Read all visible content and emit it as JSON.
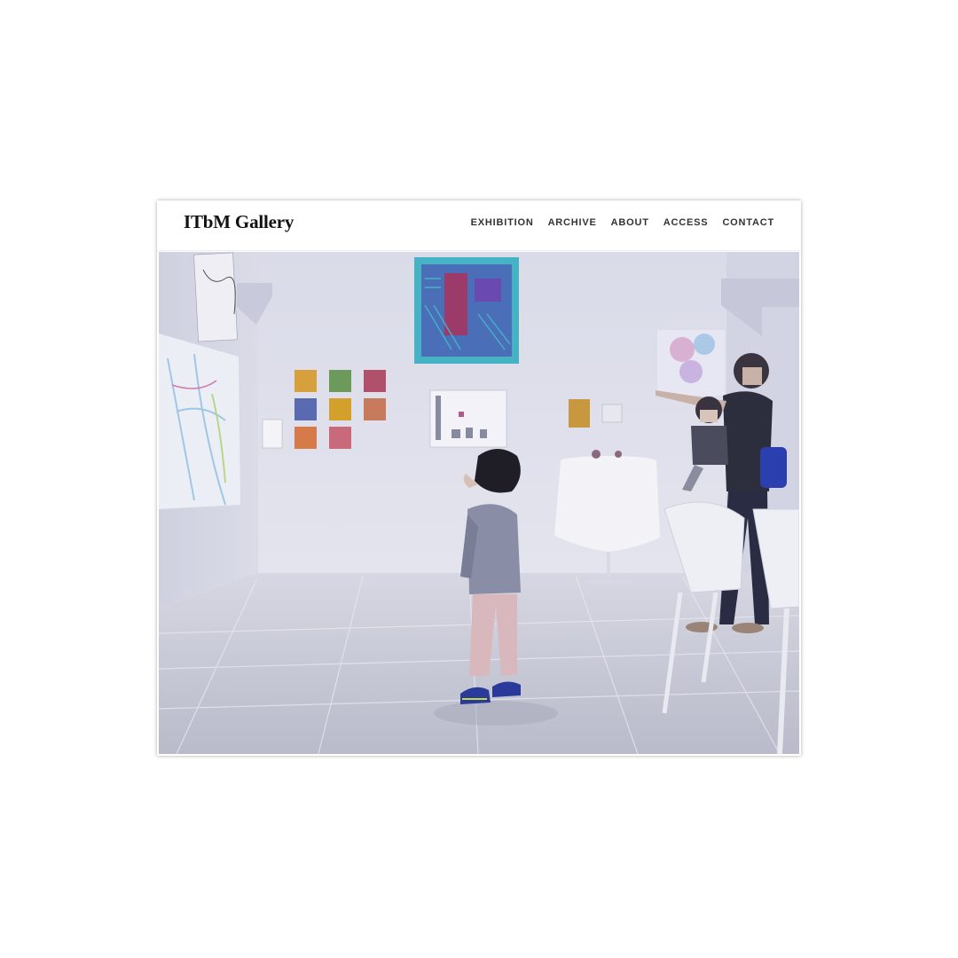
{
  "site": {
    "logo": "ITbM Gallery"
  },
  "nav": {
    "items": [
      {
        "id": "exhibition",
        "label": "EXHIBITION"
      },
      {
        "id": "archive",
        "label": "ARCHIVE"
      },
      {
        "id": "about",
        "label": "ABOUT"
      },
      {
        "id": "access",
        "label": "ACCESS"
      },
      {
        "id": "contact",
        "label": "CONTACT"
      }
    ]
  },
  "colors": {
    "wall": "#dcdde8",
    "floor": "#c7c9d6",
    "accent_painting": "#45b3c4",
    "nav_text": "#333333"
  }
}
